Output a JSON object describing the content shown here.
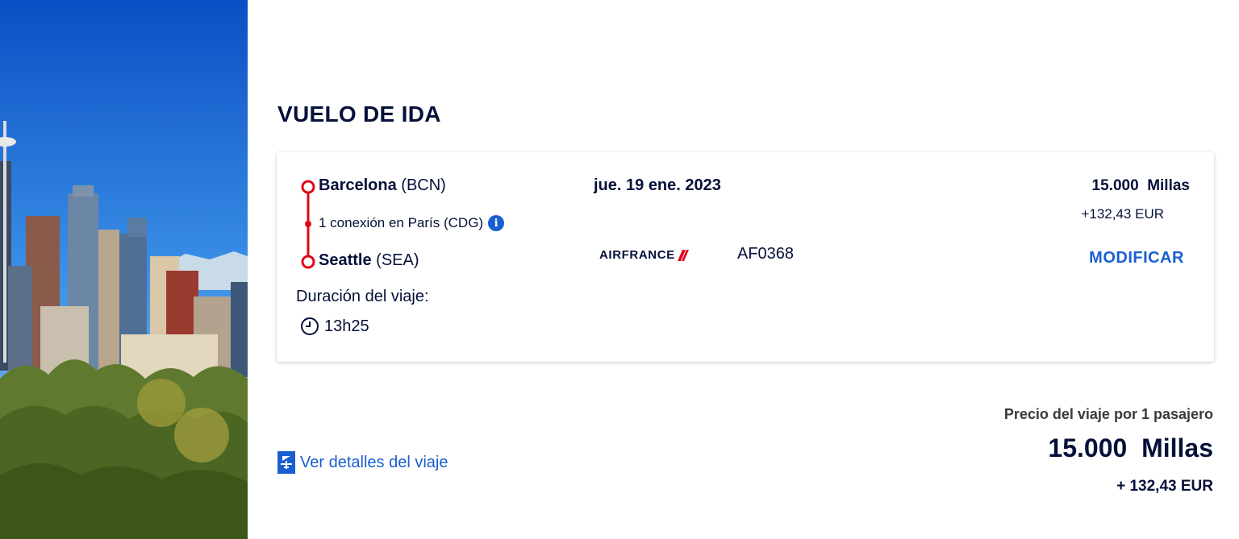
{
  "section_title": "VUELO DE IDA",
  "flight": {
    "origin_city": "Barcelona",
    "origin_code": "(BCN)",
    "connection_text": "1 conexión en París (CDG)",
    "destination_city": "Seattle",
    "destination_code": "(SEA)",
    "duration_label": "Duración del viaje:",
    "duration": "13h25",
    "date": "jue. 19 ene. 2023",
    "airline": "AIRFRANCE",
    "flight_number": "AF0368",
    "price_miles": "15.000  Millas",
    "price_eur": "+132,43 EUR",
    "modify_label": "MODIFICAR"
  },
  "details_link": "Ver detalles del viaje",
  "total": {
    "label": "Precio del viaje por 1 pasajero",
    "miles": "15.000  Millas",
    "eur": "+ 132,43 EUR"
  },
  "colors": {
    "navy": "#051039",
    "link_blue": "#1a5fd1",
    "route_red": "#e1071a"
  },
  "icons": [
    "info-icon",
    "clock-icon",
    "plane-details-icon"
  ]
}
